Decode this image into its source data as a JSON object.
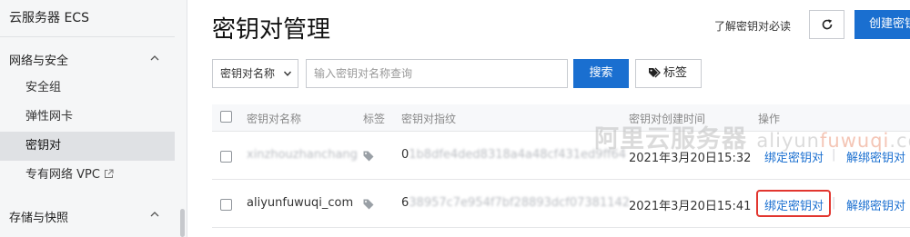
{
  "sidebar": {
    "title": "云服务器 ECS",
    "group1": "网络与安全",
    "items": [
      {
        "label": "安全组"
      },
      {
        "label": "弹性网卡"
      },
      {
        "label": "密钥对"
      },
      {
        "label": "专有网络 VPC"
      }
    ],
    "group2": "存储与快照"
  },
  "header": {
    "title": "密钥对管理",
    "help_link": "了解密钥对必读",
    "create_label": "创建密钥对"
  },
  "filter": {
    "select_value": "密钥对名称",
    "search_placeholder": "输入密钥对名称查询",
    "search_label": "搜索",
    "tag_label": "标签"
  },
  "table": {
    "columns": [
      "密钥对名称",
      "标签",
      "密钥对指纹",
      "密钥对创建时间",
      "操作"
    ],
    "rows": [
      {
        "name": "xinzhouzhanchang",
        "fingerprint_start": "0",
        "fingerprint_rest": "1b8dfe4ded8318a4a48cf431ed9ff64",
        "created": "2021年3月20日15:32",
        "action_bind": "绑定密钥对",
        "action_unbind": "解绑密钥对"
      },
      {
        "name": "aliyunfuwuqi_com",
        "fingerprint_start": "6",
        "fingerprint_rest": "38957c7e954f7bf28893dcf07381142",
        "created": "2021年3月20日15:41",
        "action_bind": "绑定密钥对",
        "action_unbind": "解绑密钥对"
      }
    ]
  },
  "watermark": {
    "brand": "阿里云服务器",
    "url_plain": "aliyun",
    "url_accent": "fuwuqi",
    "url_tail": ".com"
  },
  "colors": {
    "primary": "#1a6fd0",
    "highlight": "#e2362f",
    "sidebar_bg": "#f5f6f7"
  }
}
